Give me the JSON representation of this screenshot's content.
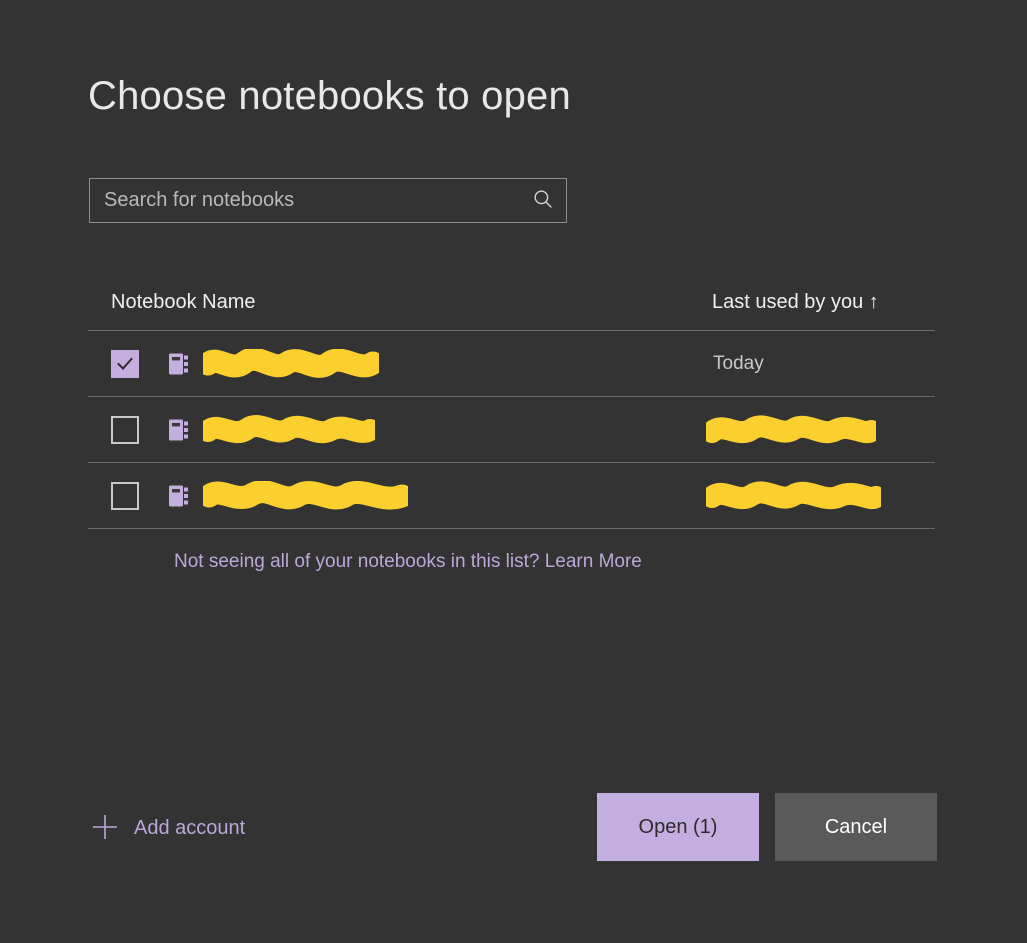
{
  "theme": {
    "background": "#333333",
    "accent_purple": "#c4aee0",
    "link_purple": "#bba8d8",
    "redaction_yellow": "#fbd02e",
    "text_primary": "#e8e8e8",
    "text_secondary": "#c9c9c9",
    "divider": "#6b6b6b",
    "cancel_gray": "#5a5a5a"
  },
  "dialog": {
    "title": "Choose notebooks to open"
  },
  "search": {
    "value": "",
    "placeholder": "Search for notebooks",
    "icon": "search-icon"
  },
  "table": {
    "columns": [
      {
        "key": "name",
        "label": "Notebook Name"
      },
      {
        "key": "last_used",
        "label": "Last used by you ↑",
        "sorted": "ascending"
      }
    ],
    "rows": [
      {
        "checked": true,
        "icon": "notebook-icon",
        "name": "",
        "name_redacted": true,
        "name_redaction_width": 176,
        "last_used": "Today",
        "last_used_redacted": false,
        "last_used_redaction_width": 0
      },
      {
        "checked": false,
        "icon": "notebook-icon",
        "name": "",
        "name_redacted": true,
        "name_redaction_width": 172,
        "last_used": "",
        "last_used_redacted": true,
        "last_used_redaction_width": 170
      },
      {
        "checked": false,
        "icon": "notebook-icon",
        "name": "",
        "name_redacted": true,
        "name_redaction_width": 205,
        "last_used": "",
        "last_used_redacted": true,
        "last_used_redaction_width": 175
      }
    ]
  },
  "helper": {
    "text": "Not seeing all of your notebooks in this list? Learn More"
  },
  "footer": {
    "add_account_label": "Add account",
    "add_account_icon": "plus-icon",
    "open_label": "Open (1)",
    "cancel_label": "Cancel",
    "selected_count": 1
  }
}
